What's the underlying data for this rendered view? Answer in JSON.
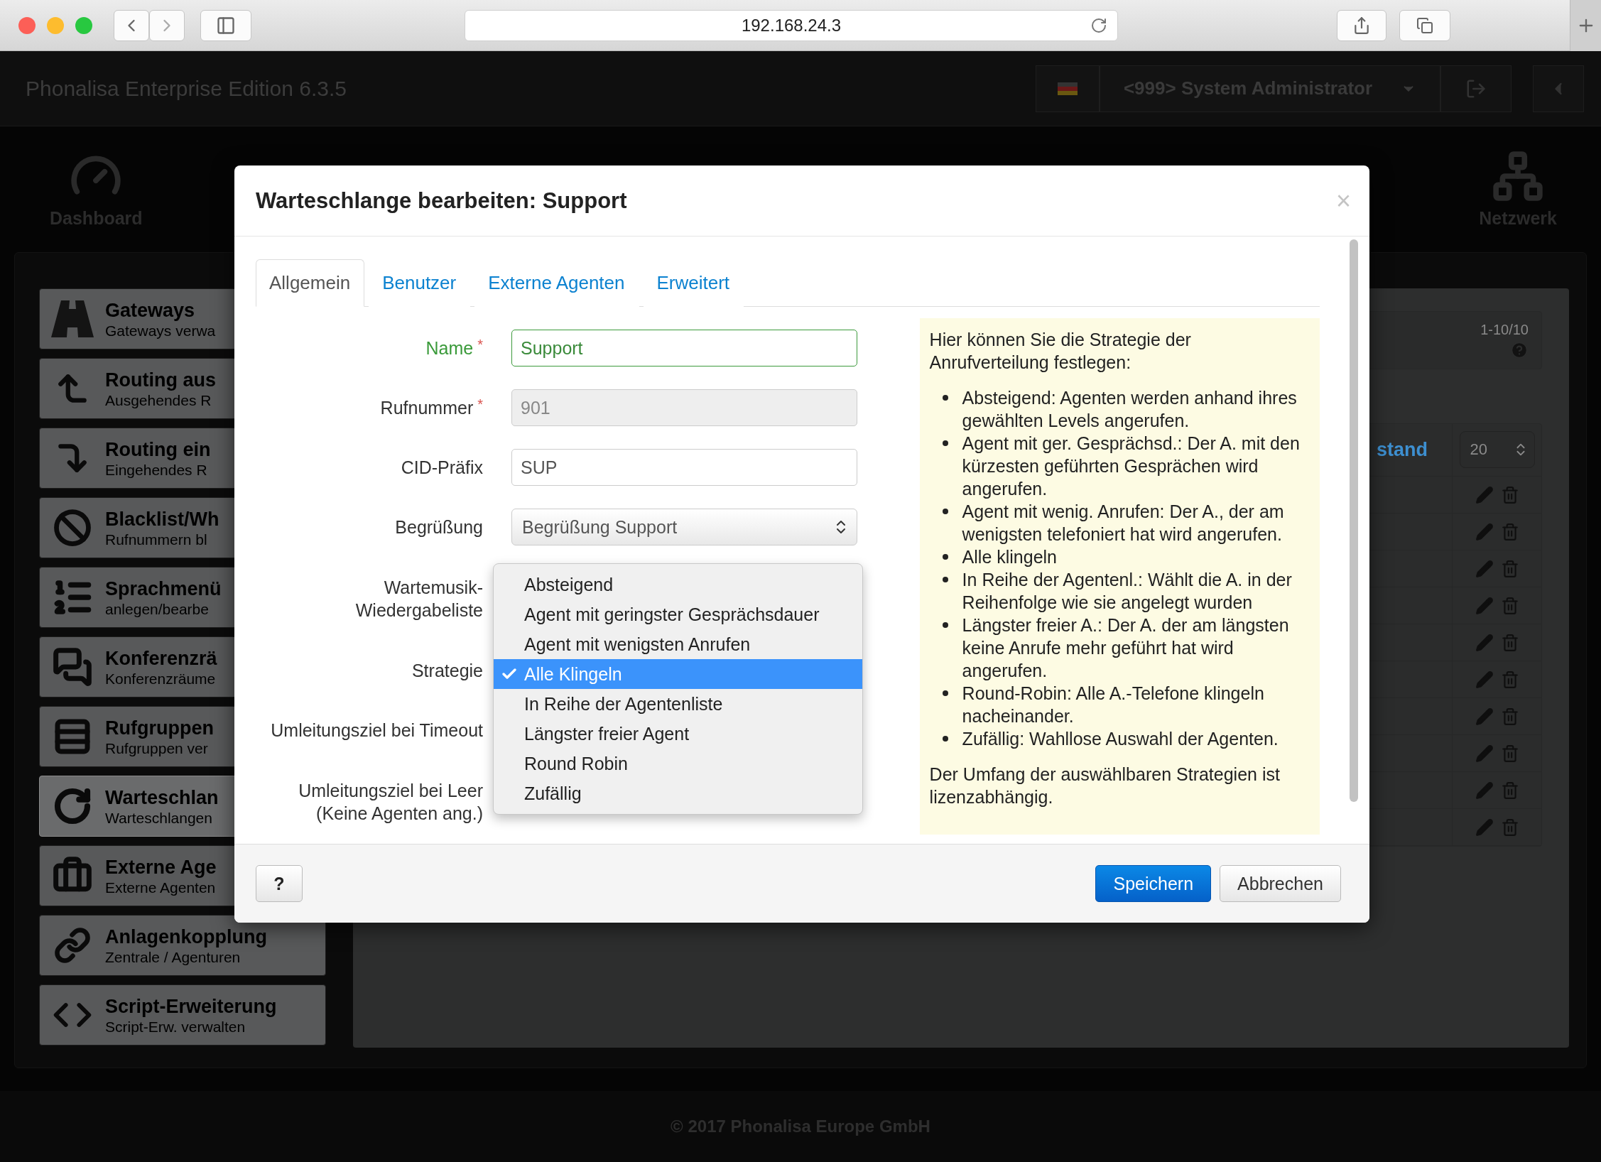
{
  "browser": {
    "url": "192.168.24.3"
  },
  "app": {
    "title": "Phonalisa Enterprise Edition 6.3.5",
    "user": "<999> System Administrator"
  },
  "nav": [
    {
      "label": "Dashboard"
    },
    {
      "label": "Netzwerk"
    }
  ],
  "sidebar": [
    {
      "title": "Gateways",
      "subtitle": "Gateways verwa",
      "selected": false
    },
    {
      "title": "Routing aus",
      "subtitle": "Ausgehendes R",
      "selected": false
    },
    {
      "title": "Routing ein",
      "subtitle": "Eingehendes R",
      "selected": false
    },
    {
      "title": "Blacklist/Wh",
      "subtitle": "Rufnummern bl",
      "selected": false
    },
    {
      "title": "Sprachmenü",
      "subtitle": "anlegen/bearbe",
      "selected": false
    },
    {
      "title": "Konferenzrä",
      "subtitle": "Konferenzräume",
      "selected": false
    },
    {
      "title": "Rufgruppen",
      "subtitle": "Rufgruppen ver",
      "selected": false
    },
    {
      "title": "Warteschlan",
      "subtitle": "Warteschlangen",
      "selected": true
    },
    {
      "title": "Externe Age",
      "subtitle": "Externe Agenten",
      "selected": false
    },
    {
      "title": "Anlagenkopplung",
      "subtitle": "Zentrale / Agenturen",
      "selected": false
    },
    {
      "title": "Script-Erweiterung",
      "subtitle": "Script-Erw. verwalten",
      "selected": false
    }
  ],
  "panel": {
    "pager": "1-10/10",
    "column_header": "stand",
    "page_size": "20"
  },
  "modal": {
    "title": "Warteschlange bearbeiten: Support",
    "close": "×",
    "tabs": [
      {
        "label": "Allgemein",
        "selected": true
      },
      {
        "label": "Benutzer",
        "selected": false
      },
      {
        "label": "Externe Agenten",
        "selected": false
      },
      {
        "label": "Erweitert",
        "selected": false
      }
    ],
    "fields": [
      {
        "label": "Name",
        "required_mark": "*",
        "kind": "text",
        "value": "Support",
        "valid": true,
        "disabled": false
      },
      {
        "label": "Rufnummer",
        "required_mark": "*",
        "kind": "text",
        "value": "901",
        "valid": false,
        "disabled": true
      },
      {
        "label": "CID-Präfix",
        "kind": "text",
        "value": "SUP",
        "valid": false,
        "disabled": false
      },
      {
        "label": "Begrüßung",
        "kind": "select",
        "value": "Begrüßung Support"
      },
      {
        "label": "Wartemusik-\nWiedergabeliste",
        "kind": "covered"
      },
      {
        "label": "Strategie",
        "kind": "covered"
      },
      {
        "label": "Umleitungsziel bei Timeout",
        "kind": "covered"
      },
      {
        "label": "Umleitungsziel bei Leer\n(Keine Agenten ang.)",
        "kind": "covered"
      }
    ],
    "strategy_options": [
      {
        "label": "Absteigend",
        "selected": false
      },
      {
        "label": "Agent mit geringster Gesprächsdauer",
        "selected": false
      },
      {
        "label": "Agent mit wenigsten Anrufen",
        "selected": false
      },
      {
        "label": "Alle Klingeln",
        "selected": true
      },
      {
        "label": "In Reihe der Agentenliste",
        "selected": false
      },
      {
        "label": "Längster freier Agent",
        "selected": false
      },
      {
        "label": "Round Robin",
        "selected": false
      },
      {
        "label": "Zufällig",
        "selected": false
      }
    ],
    "help": {
      "intro": "Hier können Sie die Strategie der Anrufverteilung festlegen:",
      "bullets": [
        "Absteigend: Agenten werden anhand ihres gewählten Levels angerufen.",
        "Agent mit ger. Gesprächsd.: Der A. mit den kürzesten geführten Gesprächen wird angerufen.",
        "Agent mit wenig. Anrufen: Der A., der am wenigsten telefoniert hat wird angerufen.",
        "Alle klingeln",
        "In Reihe der Agentenl.: Wählt die A. in der Reihenfolge wie sie angelegt wurden",
        "Längster freier A.: Der A. der am längsten keine Anrufe mehr geführt hat wird angerufen.",
        "Round-Robin: Alle A.-Telefone klingeln nacheinander.",
        "Zufällig: Wahllose Auswahl der Agenten."
      ],
      "note": "Der Umfang der auswählbaren Strategien ist lizenzabhängig."
    },
    "buttons": [
      {
        "label": "?",
        "kind": "help"
      },
      {
        "label": "Speichern",
        "kind": "primary"
      },
      {
        "label": "Abbrechen",
        "kind": "default"
      }
    ]
  },
  "footer": "© 2017 Phonalisa Europe GmbH"
}
